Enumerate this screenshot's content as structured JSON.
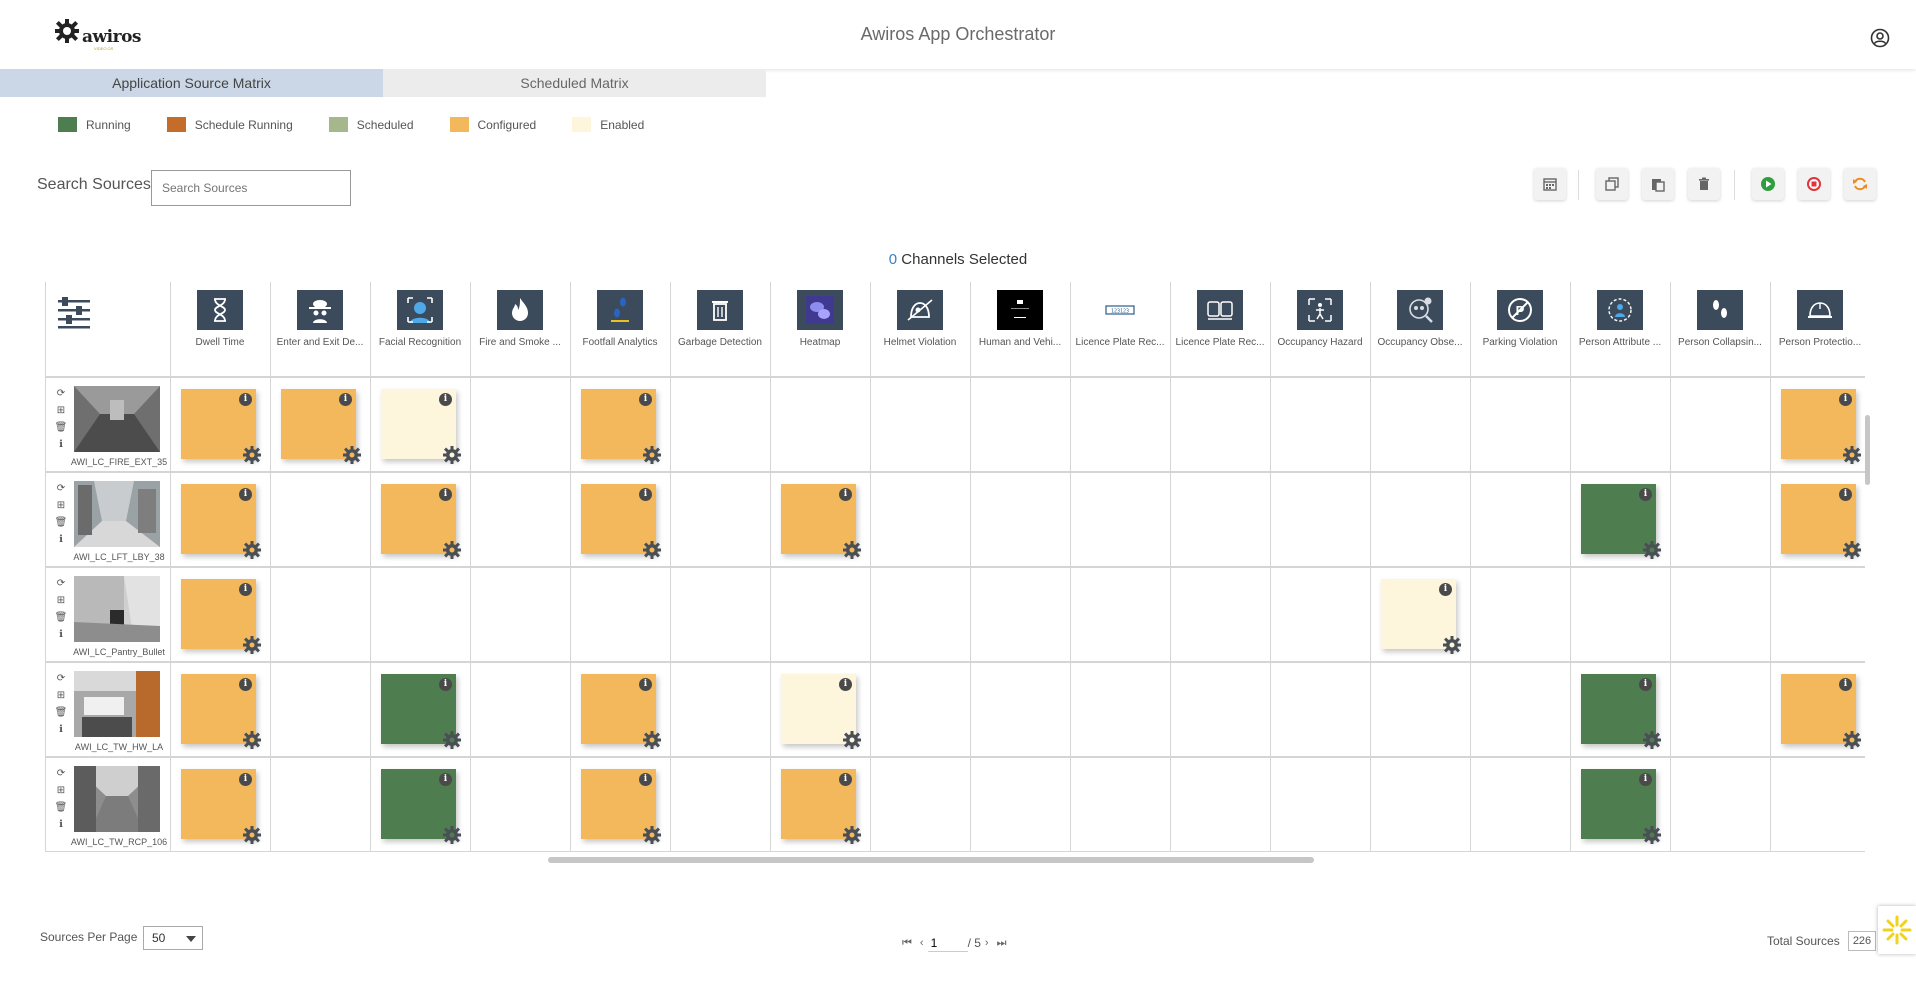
{
  "header": {
    "logo_text": "awiros",
    "logo_sub": "VIDEO OS",
    "title": "Awiros App Orchestrator"
  },
  "tabs": [
    {
      "label": "Application Source Matrix",
      "active": true
    },
    {
      "label": "Scheduled Matrix",
      "active": false
    }
  ],
  "legend": [
    {
      "label": "Running",
      "color": "#4e7d4f"
    },
    {
      "label": "Schedule Running",
      "color": "#c46c2a"
    },
    {
      "label": "Scheduled",
      "color": "#a6b68d"
    },
    {
      "label": "Configured",
      "color": "#f3b85c"
    },
    {
      "label": "Enabled",
      "color": "#fdf5dc"
    }
  ],
  "search": {
    "label": "Search Sources",
    "placeholder": "Search Sources"
  },
  "toolbar": {
    "buttons": [
      {
        "name": "schedule-button",
        "icon": "calendar-icon",
        "color": "#666666"
      },
      {
        "name": "copy-button",
        "icon": "copy-icon",
        "color": "#666666"
      },
      {
        "name": "paste-button",
        "icon": "paste-icon",
        "color": "#666666"
      },
      {
        "name": "delete-button",
        "icon": "trash-icon",
        "color": "#666666"
      },
      {
        "name": "start-button",
        "icon": "play-icon",
        "color": "#2e9e3e"
      },
      {
        "name": "stop-button",
        "icon": "stop-icon",
        "color": "#e0343a"
      },
      {
        "name": "restart-button",
        "icon": "refresh-icon",
        "color": "#ef8a1c"
      }
    ]
  },
  "channels": {
    "count": "0",
    "label": "Channels Selected"
  },
  "apps": [
    "Dwell Time",
    "Enter and Exit De...",
    "Facial Recognition",
    "Fire and Smoke ...",
    "Footfall Analytics",
    "Garbage Detection",
    "Heatmap",
    "Helmet Violation",
    "Human and Vehi...",
    "Licence Plate Rec...",
    "Licence Plate Rec...",
    "Occupancy Hazard",
    "Occupancy Obse...",
    "Parking Violation",
    "Person Attribute ...",
    "Person Collapsin...",
    "Person Protectio..."
  ],
  "app_icons": [
    "hourglass-icon",
    "spy-icon",
    "face-icon",
    "fire-icon",
    "footfall-icon",
    "garbage-icon",
    "heatmap-icon",
    "helmet-icon",
    "human-vehicle-icon",
    "license-plate-icon",
    "vehicles-icon",
    "occupancy-hazard-icon",
    "occupancy-observe-icon",
    "no-parking-icon",
    "person-attribute-icon",
    "person-collapsing-icon",
    "hard-hat-icon"
  ],
  "sources": [
    {
      "name": "AWI_LC_FIRE_EXT_35",
      "cells": {
        "0": "configured",
        "1": "configured",
        "2": "enabled",
        "4": "configured",
        "16": "configured"
      }
    },
    {
      "name": "AWI_LC_LFT_LBY_38",
      "cells": {
        "0": "configured",
        "2": "configured",
        "4": "configured",
        "6": "configured",
        "14": "running",
        "16": "configured"
      }
    },
    {
      "name": "AWI_LC_Pantry_Bullet",
      "cells": {
        "0": "configured",
        "12": "enabled"
      }
    },
    {
      "name": "AWI_LC_TW_HW_LA",
      "cells": {
        "0": "configured",
        "2": "running",
        "4": "configured",
        "6": "enabled",
        "14": "running",
        "16": "configured"
      }
    },
    {
      "name": "AWI_LC_TW_RCP_106",
      "cells": {
        "0": "configured",
        "2": "running",
        "4": "configured",
        "6": "configured",
        "14": "running"
      }
    }
  ],
  "status_colors": {
    "running": "#4e7d4f",
    "configured": "#f3b85c",
    "enabled": "#fdf5dc"
  },
  "footer": {
    "per_page_label": "Sources Per Page",
    "per_page_value": "50",
    "page_current": "1",
    "page_total": "/ 5",
    "total_label": "Total Sources",
    "total_value": "226"
  }
}
